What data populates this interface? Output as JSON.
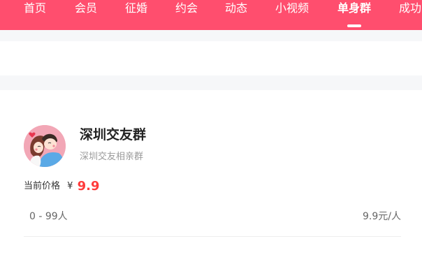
{
  "nav": {
    "items": [
      "首页",
      "会员",
      "征婚",
      "约会",
      "动态",
      "小视频",
      "单身群",
      "成功"
    ],
    "active": "单身群",
    "color": "#ff4e6e"
  },
  "group": {
    "name": "深圳交友群",
    "description": "深圳交友相亲群",
    "price_label": "当前价格",
    "currency": "¥",
    "price": "9.9",
    "range": "0 - 99人",
    "unit_price": "9.9元/人",
    "avatar": "couple-avatar-icon"
  }
}
